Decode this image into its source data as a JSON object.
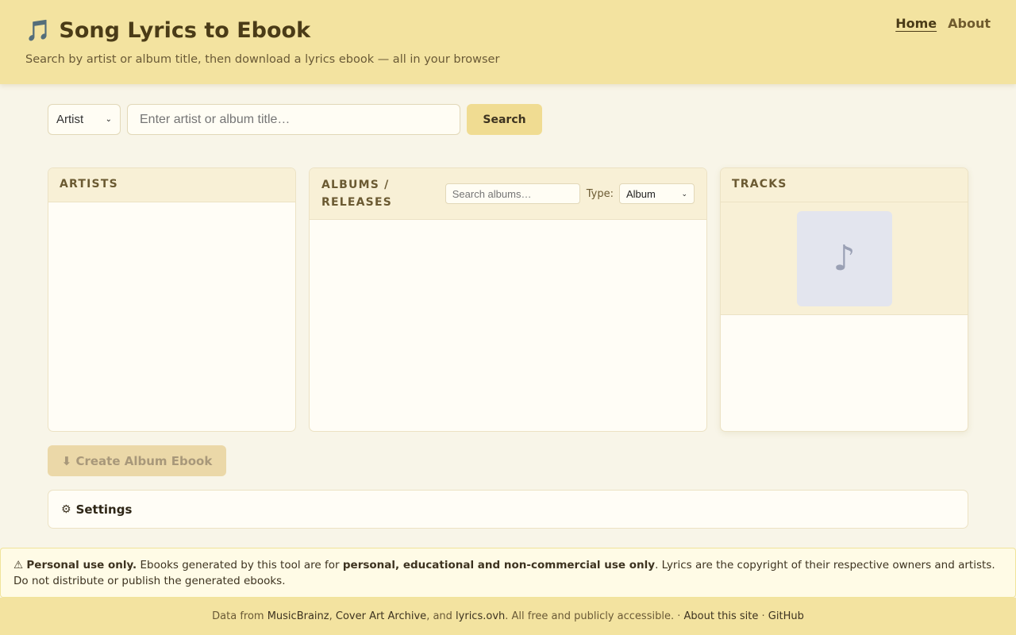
{
  "header": {
    "icon": "music-note-icon",
    "title": "Song Lyrics to Ebook",
    "tagline": "Search by artist or album title, then download a lyrics ebook — all in your browser",
    "nav": [
      {
        "label": "Home",
        "active": true
      },
      {
        "label": "About",
        "active": false
      }
    ]
  },
  "search": {
    "mode_selected": "Artist",
    "placeholder": "Enter artist or album title…",
    "value": "",
    "button_label": "Search"
  },
  "panels": {
    "artists": {
      "title": "ARTISTS",
      "items": []
    },
    "albums": {
      "title_line1": "ALBUMS /",
      "title_line2": "RELEASES",
      "search_placeholder": "Search albums…",
      "type_label": "Type:",
      "type_selected": "Album",
      "items": []
    },
    "tracks": {
      "title": "TRACKS",
      "cover_icon": "♪",
      "items": []
    }
  },
  "actions": {
    "create_ebook_label": "⬇ Create Album Ebook",
    "create_ebook_enabled": false
  },
  "settings": {
    "icon": "⚙",
    "label": "Settings"
  },
  "notice": {
    "warn_icon": "⚠",
    "lead": "Personal use only.",
    "text1": " Ebooks generated by this tool are for ",
    "emph": "personal, educational and non-commercial use only",
    "text2": ". Lyrics are the copyright of their respective owners and artists. Do not distribute or publish the generated ebooks."
  },
  "footer": {
    "prefix": "Data from ",
    "link1": "MusicBrainz",
    "sep1": ", ",
    "link2": "Cover Art Archive",
    "sep2": ", and ",
    "link3": "lyrics.ovh",
    "middle": ". All free and publicly accessible. · ",
    "link4": "About this site",
    "sep3": " · ",
    "link5": "GitHub"
  },
  "colors": {
    "header_bg": "#f3e3a0",
    "page_bg": "#f8f5e8",
    "accent_button": "#f0dc92",
    "notice_bg": "#fffbe6"
  }
}
